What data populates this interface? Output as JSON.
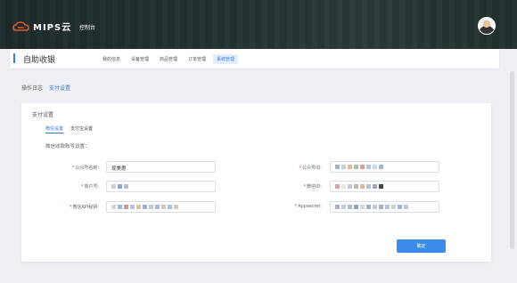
{
  "app": {
    "brand": "MIPS云",
    "console": "控制台"
  },
  "header": {
    "title": "自助收银",
    "nav": [
      "我的信息",
      "设备管理",
      "商品管理",
      "订单管理",
      "系统管理"
    ],
    "active_nav_index": 4
  },
  "breadcrumb": {
    "section": "操作日志",
    "current": "支付设置"
  },
  "panel": {
    "title": "支付设置",
    "tabs": [
      "微信设置",
      "支付宝设置"
    ],
    "active_tab_index": 0,
    "section_label": "微信收款账号设置：",
    "fields": {
      "account_name": {
        "label": "公众号名称:",
        "value": "现美惠"
      },
      "account_id": {
        "label": "公众号ID:"
      },
      "merchant_no": {
        "label": "商户号:"
      },
      "wechat_id": {
        "label": "微信ID:"
      },
      "api_key": {
        "label": "微信API秘钥:"
      },
      "appsecret": {
        "label": "Appsecret:"
      }
    },
    "confirm_label": "确定"
  },
  "colors": {
    "accent": "#3a7bd5",
    "button": "#3d8be8",
    "required": "#e53935"
  }
}
